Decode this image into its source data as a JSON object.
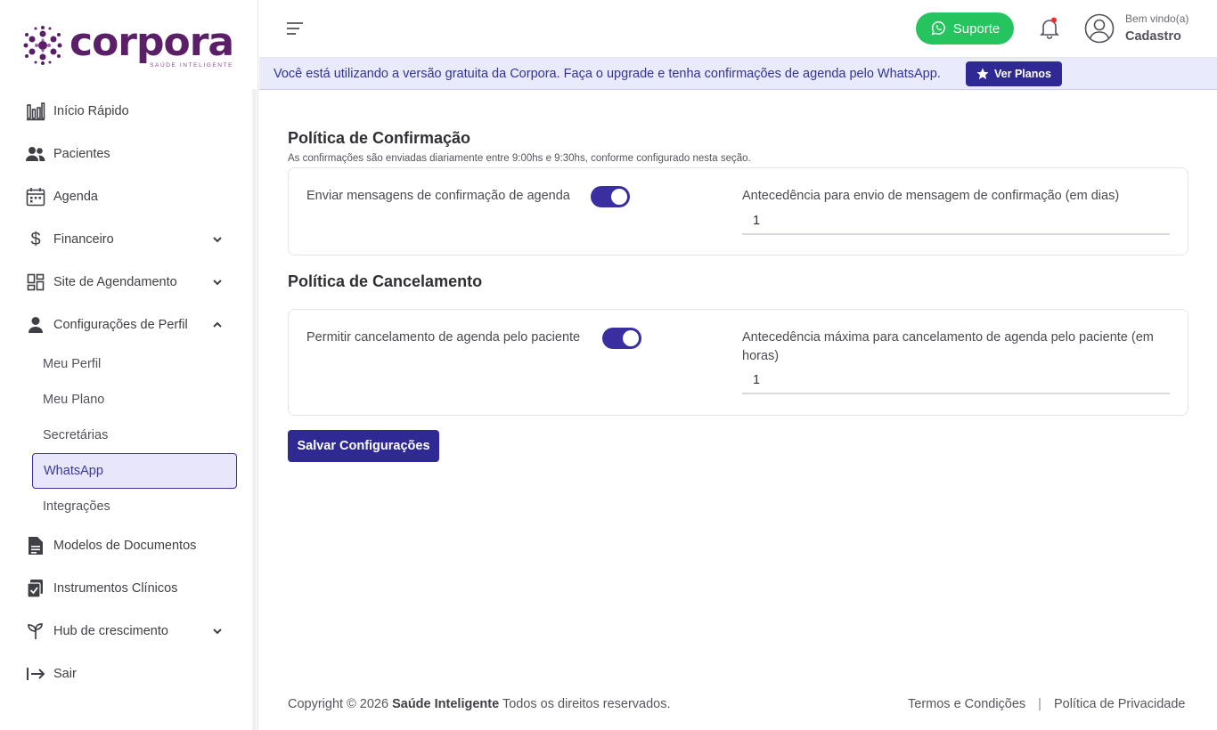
{
  "brand": {
    "name": "corpora",
    "tagline": "SAÚDE INTELIGENTE",
    "primary_color": "#2f2a93",
    "logo_color": "#5b1f68"
  },
  "sidebar": {
    "items": [
      {
        "label": "Início Rápido",
        "icon": "bar-chart-icon"
      },
      {
        "label": "Pacientes",
        "icon": "users-icon"
      },
      {
        "label": "Agenda",
        "icon": "calendar-icon"
      },
      {
        "label": "Financeiro",
        "icon": "dollar-icon",
        "expandable": true
      },
      {
        "label": "Site de Agendamento",
        "icon": "dashboard-icon",
        "expandable": true
      },
      {
        "label": "Configurações de Perfil",
        "icon": "user-icon",
        "expanded": true
      },
      {
        "label": "Modelos de Documentos",
        "icon": "document-icon"
      },
      {
        "label": "Instrumentos Clínicos",
        "icon": "clipboard-check-icon"
      },
      {
        "label": "Hub de crescimento",
        "icon": "sprout-icon",
        "expandable": true
      },
      {
        "label": "Sair",
        "icon": "logout-icon"
      }
    ],
    "profile_subitems": [
      {
        "label": "Meu Perfil"
      },
      {
        "label": "Meu Plano"
      },
      {
        "label": "Secretárias"
      },
      {
        "label": "WhatsApp",
        "active": true
      },
      {
        "label": "Integrações"
      }
    ]
  },
  "header": {
    "support_label": "Suporte",
    "welcome": "Bem vindo(a)",
    "user_name": "Cadastro"
  },
  "banner": {
    "text": "Você está utilizando a versão gratuita da Corpora. Faça o upgrade e tenha confirmações de agenda pelo WhatsApp.",
    "button_label": "Ver Planos"
  },
  "confirmation": {
    "title": "Política de Confirmação",
    "subtitle": "As confirmações são enviadas diariamente entre 9:00hs e 9:30hs, conforme configurado nesta seção.",
    "toggle_label": "Enviar mensagens de confirmação de agenda",
    "toggle_on": true,
    "field_label": "Antecedência para envio de mensagem de confirmação (em dias)",
    "field_value": "1"
  },
  "cancellation": {
    "title": "Política de Cancelamento",
    "toggle_label": "Permitir cancelamento de agenda pelo paciente",
    "toggle_on": true,
    "field_label": "Antecedência máxima para cancelamento de agenda pelo paciente (em horas)",
    "field_value": "1"
  },
  "save_label": "Salvar Configurações",
  "footer": {
    "copyright_prefix": "Copyright © 2026",
    "company": "Saúde Inteligente",
    "copyright_suffix": "Todos os direitos reservados.",
    "terms": "Termos e Condições",
    "privacy": "Política de Privacidade"
  }
}
